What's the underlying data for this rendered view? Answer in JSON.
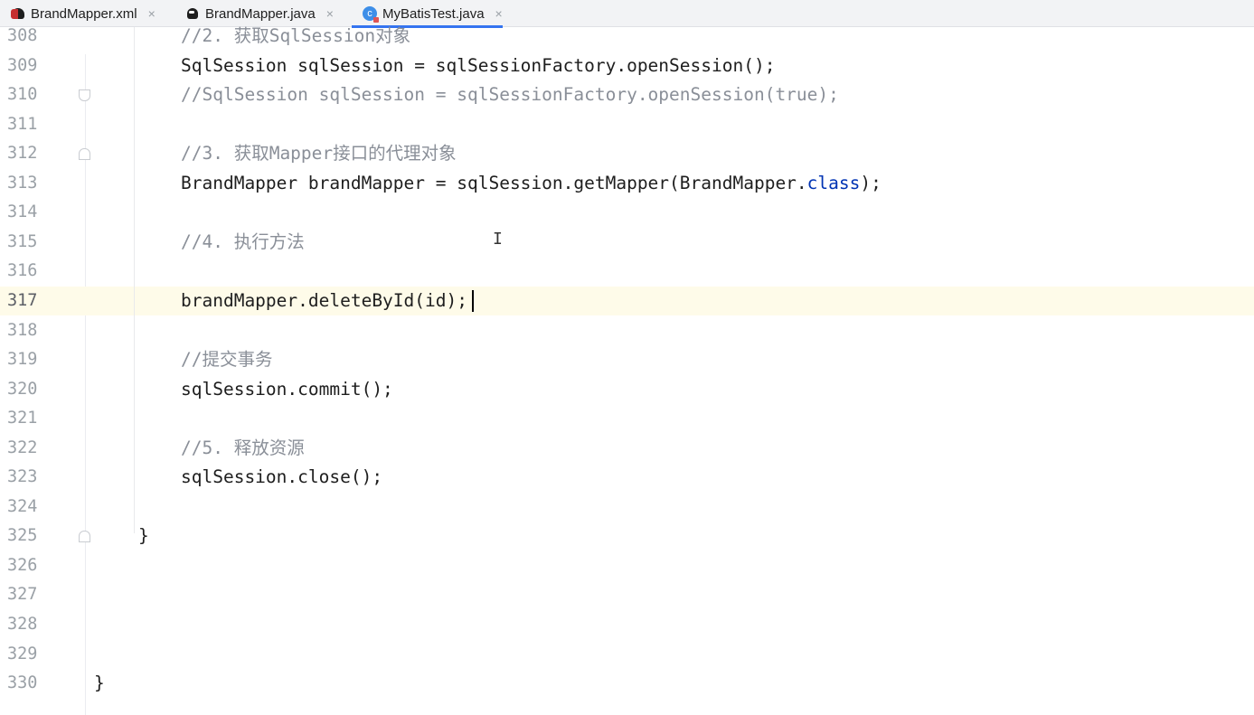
{
  "tabs": [
    {
      "label": "BrandMapper.xml",
      "icon": "xml-mapper-icon",
      "active": false
    },
    {
      "label": "BrandMapper.java",
      "icon": "java-interface-icon",
      "active": false
    },
    {
      "label": "MyBatisTest.java",
      "icon": "java-class-icon",
      "active": true
    }
  ],
  "close_glyph": "×",
  "class_icon_letter": "c",
  "lines": [
    {
      "n": "308",
      "code": "//2. 获取SqlSession对象",
      "comment": true
    },
    {
      "n": "309",
      "code": "SqlSession sqlSession = sqlSessionFactory.openSession();"
    },
    {
      "n": "310",
      "code": "//SqlSession sqlSession = sqlSessionFactory.openSession(true);",
      "comment": true
    },
    {
      "n": "311",
      "code": ""
    },
    {
      "n": "312",
      "code": "//3. 获取Mapper接口的代理对象",
      "comment": true
    },
    {
      "n": "313",
      "code_pre": "BrandMapper brandMapper = sqlSession.getMapper(BrandMapper.",
      "code_kw": "class",
      "code_post": ");"
    },
    {
      "n": "314",
      "code": ""
    },
    {
      "n": "315",
      "code": "//4. 执行方法",
      "comment": true
    },
    {
      "n": "316",
      "code": ""
    },
    {
      "n": "317",
      "code": "brandMapper.deleteById(id);",
      "current": true
    },
    {
      "n": "318",
      "code": ""
    },
    {
      "n": "319",
      "code": "//提交事务",
      "comment": true
    },
    {
      "n": "320",
      "code": "sqlSession.commit();"
    },
    {
      "n": "321",
      "code": ""
    },
    {
      "n": "322",
      "code": "//5. 释放资源",
      "comment": true
    },
    {
      "n": "323",
      "code": "sqlSession.close();"
    },
    {
      "n": "324",
      "code": ""
    },
    {
      "n": "325",
      "code": "}"
    },
    {
      "n": "326",
      "code": ""
    },
    {
      "n": "327",
      "code": ""
    },
    {
      "n": "328",
      "code": ""
    },
    {
      "n": "329",
      "code": ""
    },
    {
      "n": "330",
      "code": "}"
    }
  ],
  "colors": {
    "keyword": "#0033b3",
    "comment": "#8a8f98",
    "current_line": "#fefbe9",
    "tab_underline": "#3574f0"
  }
}
